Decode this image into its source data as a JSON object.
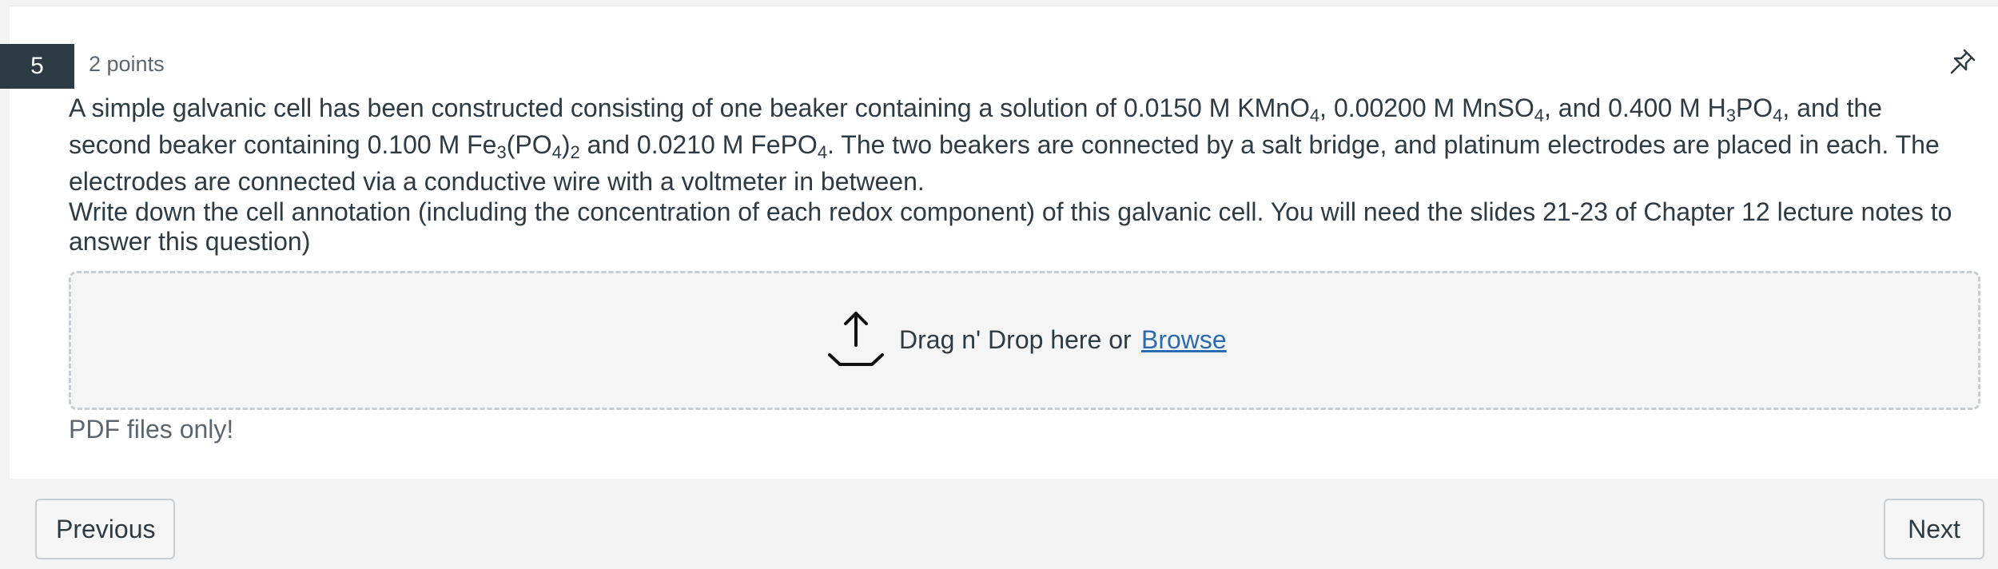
{
  "question": {
    "number": "5",
    "points": "2 points",
    "paragraph1": [
      "A simple galvanic cell has been constructed consisting of one beaker containing a solution of 0.0150 M KMnO",
      {
        "sub": "4"
      },
      ", 0.00200 M MnSO",
      {
        "sub": "4"
      },
      ", and 0.400 M H",
      {
        "sub": "3"
      },
      "PO",
      {
        "sub": "4"
      },
      ", and the second beaker containing 0.100 M Fe",
      {
        "sub": "3"
      },
      "(PO",
      {
        "sub": "4"
      },
      ")",
      {
        "sub": "2"
      },
      " and 0.0210 M FePO",
      {
        "sub": "4"
      },
      ". The two beakers are connected by a salt bridge, and platinum electrodes are placed in each. The electrodes are connected via a conductive wire with a voltmeter in between."
    ],
    "paragraph2": "Write down the cell annotation (including the concentration of each redox component) of this galvanic cell. You will need the slides 21-23 of Chapter 12 lecture notes to answer this question)"
  },
  "upload": {
    "icon": "upload-icon",
    "drop_label": "Drag n' Drop here or",
    "browse_label": "Browse",
    "hint": "PDF files only!"
  },
  "pin_icon": "pin-icon",
  "navigation": {
    "previous_label": "Previous",
    "next_label": "Next"
  },
  "colors": {
    "question_badge": "#2d3b45",
    "link": "#2b6cb0",
    "text": "#2d3b45",
    "muted": "#5b6770"
  }
}
